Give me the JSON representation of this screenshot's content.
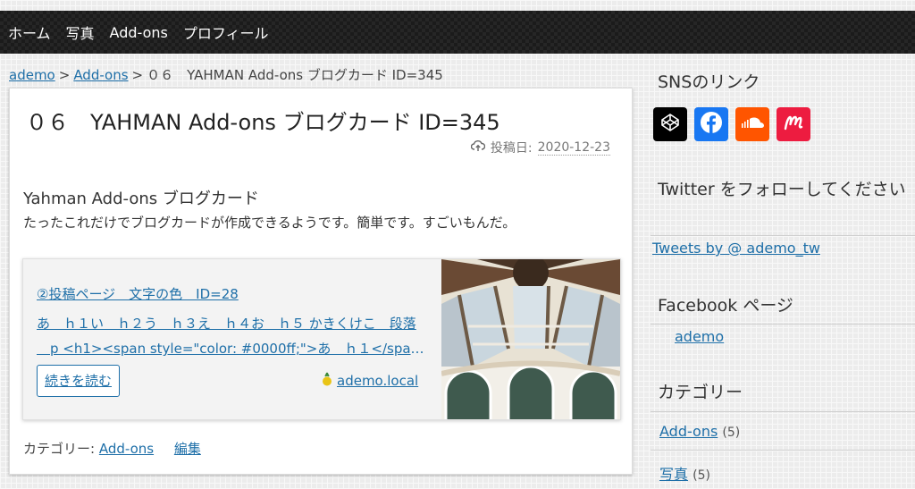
{
  "nav": {
    "items": [
      "ホーム",
      "写真",
      "Add-ons",
      "プロフィール"
    ]
  },
  "breadcrumb": {
    "home": "ademo",
    "category": "Add-ons",
    "separator": ">",
    "current": "０６　YAHMAN Add-ons ブログカード ID=345"
  },
  "article": {
    "title": "０６　YAHMAN Add-ons ブログカード ID=345",
    "posted_label": "投稿日:",
    "posted_date": "2020-12-23",
    "subtitle": "Yahman Add-ons ブログカード",
    "body": "たったこれだけでブログカードが作成できるようです。簡単です。すごいもんだ。",
    "blogcard": {
      "title": "②投稿ページ　文字の色　ID=28",
      "excerpt_line1": "あ　ｈ１い　ｈ２う　ｈ３え　ｈ４お　ｈ５ かきくけこ　段落",
      "excerpt_line2": "　p <h1><span style=\"color: #0000ff;\">あ　ｈ１</span>...",
      "read_more": "続きを読む",
      "site": "ademo.local"
    },
    "footer": {
      "category_label": "カテゴリー:",
      "category": "Add-ons",
      "edit": "編集"
    }
  },
  "sidebar": {
    "sns_title": "SNSのリンク",
    "sns_icons": [
      "codepen-icon",
      "facebook-icon",
      "soundcloud-icon",
      "meetup-icon"
    ],
    "twitter_title": "Twitter をフォローしてください",
    "twitter_link": "Tweets by @ ademo_tw",
    "facebook_title": "Facebook ページ",
    "facebook_link": "ademo",
    "categories_title": "カテゴリー",
    "categories": [
      {
        "name": "Add-ons",
        "count": "(5)"
      },
      {
        "name": "写真",
        "count": "(5)"
      }
    ]
  },
  "colors": {
    "link": "#1e6fa8",
    "facebook": "#1877f2",
    "soundcloud": "#ff5500",
    "meetup": "#ed1c40",
    "codepen": "#000000"
  }
}
